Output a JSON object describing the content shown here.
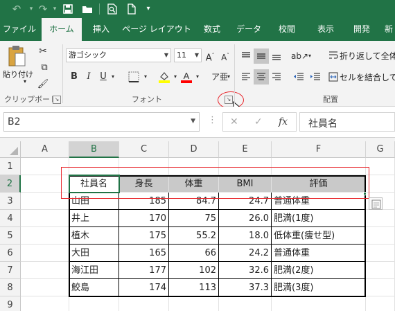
{
  "quick_access": {
    "undo": "↶",
    "redo": "↷",
    "save": "🖫",
    "folder": "▰",
    "print_preview": "🔍",
    "new": "🗋",
    "customize": "▾"
  },
  "tabs": [
    "ファイル",
    "ホーム",
    "挿入",
    "ページ レイアウト",
    "数式",
    "データ",
    "校閲",
    "表示",
    "開発",
    "新"
  ],
  "active_tab": "ホーム",
  "ribbon": {
    "clipboard": {
      "paste_label": "貼り付け",
      "group_label": "クリップボード"
    },
    "font": {
      "font_name": "游ゴシック",
      "font_size": "11",
      "bold": "B",
      "italic": "I",
      "underline": "U",
      "grow": "A˄",
      "shrink": "A˅",
      "group_label": "フォント"
    },
    "alignment": {
      "wrap_text": "折り返して全体を",
      "merge_center": "セルを結合して中",
      "group_label": "配置"
    },
    "colors": {
      "highlight": "#ffff00",
      "font_color": "#ff0000"
    }
  },
  "formula_bar": {
    "name_box": "B2",
    "cancel": "✕",
    "enter": "✓",
    "fx": "fx",
    "content": "社員名"
  },
  "sheet": {
    "columns": [
      "A",
      "B",
      "C",
      "D",
      "E",
      "F",
      "G"
    ],
    "rows": [
      "1",
      "2",
      "3",
      "4",
      "5",
      "6",
      "7",
      "8",
      "9"
    ],
    "headers": [
      "社員名",
      "身長",
      "体重",
      "BMI",
      "評価"
    ],
    "data": [
      [
        "山田",
        "185",
        "84.7",
        "24.7",
        "普通体重"
      ],
      [
        "井上",
        "170",
        "75",
        "26.0",
        "肥満(1度)"
      ],
      [
        "植木",
        "175",
        "55.2",
        "18.0",
        "低体重(痩せ型)"
      ],
      [
        "大田",
        "165",
        "66",
        "24.2",
        "普通体重"
      ],
      [
        "海江田",
        "177",
        "102",
        "32.6",
        "肥満(2度)"
      ],
      [
        "鮫島",
        "174",
        "113",
        "37.3",
        "肥満(3度)"
      ]
    ]
  },
  "theme": {
    "accent": "#217346",
    "annotation": "#ff0000"
  }
}
